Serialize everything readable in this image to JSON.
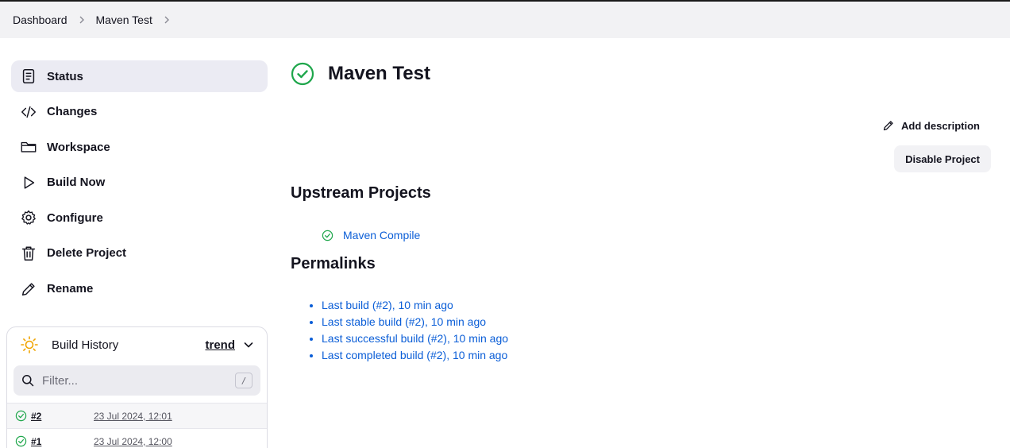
{
  "breadcrumb": [
    {
      "label": "Dashboard"
    },
    {
      "label": "Maven Test"
    }
  ],
  "sidebar": {
    "items": [
      {
        "label": "Status",
        "icon": "status-icon"
      },
      {
        "label": "Changes",
        "icon": "code-icon"
      },
      {
        "label": "Workspace",
        "icon": "folder-icon"
      },
      {
        "label": "Build Now",
        "icon": "play-icon"
      },
      {
        "label": "Configure",
        "icon": "gear-icon"
      },
      {
        "label": "Delete Project",
        "icon": "trash-icon"
      },
      {
        "label": "Rename",
        "icon": "pencil-icon"
      }
    ]
  },
  "build_history": {
    "title": "Build History",
    "trend_label": "trend",
    "filter_placeholder": "Filter...",
    "filter_shortcut": "/",
    "builds": [
      {
        "number": "#2",
        "date": "23 Jul 2024, 12:01",
        "status": "success"
      },
      {
        "number": "#1",
        "date": "23 Jul 2024, 12:00",
        "status": "success"
      }
    ]
  },
  "main": {
    "title": "Maven Test",
    "status": "success",
    "add_description_label": "Add description",
    "disable_label": "Disable Project",
    "upstream_heading": "Upstream Projects",
    "upstream_projects": [
      {
        "label": "Maven Compile",
        "status": "success"
      }
    ],
    "permalinks_heading": "Permalinks",
    "permalinks": [
      {
        "label": "Last build (#2), 10 min ago"
      },
      {
        "label": "Last stable build (#2), 10 min ago"
      },
      {
        "label": "Last successful build (#2), 10 min ago"
      },
      {
        "label": "Last completed build (#2), 10 min ago"
      }
    ]
  },
  "colors": {
    "success": "#1ea64b",
    "link": "#0b5ed7",
    "sun": "#f0a400"
  }
}
